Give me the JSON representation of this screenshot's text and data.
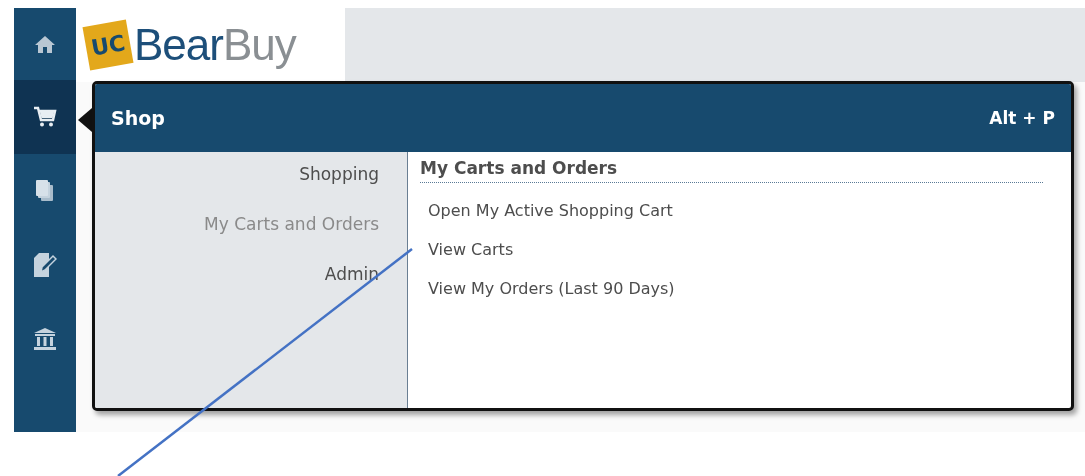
{
  "sidebar": {
    "items": [
      {
        "kind": "home",
        "selected": false
      },
      {
        "kind": "cart",
        "selected": true
      },
      {
        "kind": "documents",
        "selected": false
      },
      {
        "kind": "edit",
        "selected": false
      },
      {
        "kind": "bank",
        "selected": false
      }
    ]
  },
  "logo": {
    "badge": "UC",
    "name_parts": [
      "Bear",
      "Buy"
    ]
  },
  "menu": {
    "title": "Shop",
    "shortcut": "Alt + P",
    "categories": [
      {
        "label": "Shopping",
        "selected": false
      },
      {
        "label": "My Carts and Orders",
        "selected": true
      },
      {
        "label": "Admin",
        "selected": false
      }
    ],
    "section": {
      "heading": "My Carts and Orders",
      "links": [
        "Open My Active Shopping Cart",
        "View Carts",
        "View My Orders (Last 90 Days)"
      ]
    }
  }
}
